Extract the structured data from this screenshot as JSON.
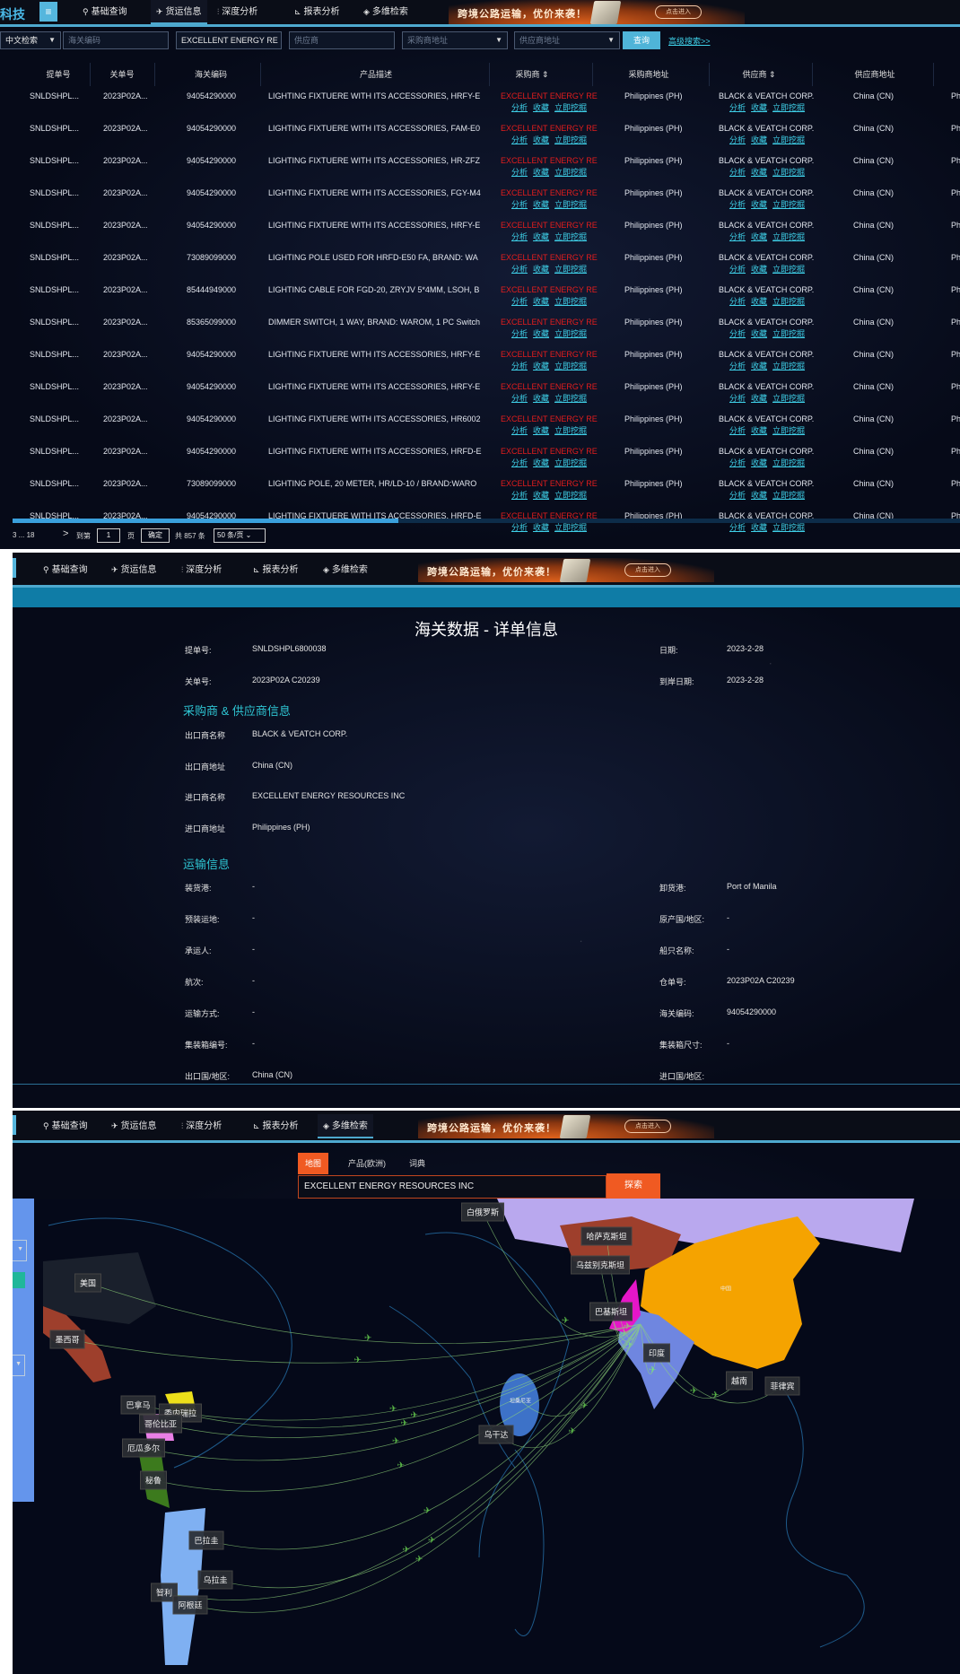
{
  "nav": {
    "logo": "科技",
    "menu_icon": "≡",
    "items": [
      "基础查询",
      "货运信息",
      "深度分析",
      "报表分析",
      "多维检索"
    ],
    "banner_text": "跨境公路运输，优价来袭！",
    "banner_button": "点击进入"
  },
  "filters": {
    "lang_select": "中文检索",
    "hs_placeholder": "海关编码",
    "buyer_value": "EXCELLENT ENERGY RE",
    "supplier_placeholder": "供应商",
    "buyer_addr_placeholder": "采购商地址",
    "supplier_addr_placeholder": "供应商地址",
    "query_button": "查询",
    "advanced_link": "高级搜索>>"
  },
  "table": {
    "headers": [
      "提单号",
      "关单号",
      "海关编码",
      "产品描述",
      "采购商 ⇕",
      "采购商地址",
      "供应商 ⇕",
      "供应商地址"
    ],
    "link_labels": [
      "分析",
      "收藏",
      "立即挖掘"
    ],
    "rows": [
      {
        "bill": "SNLDSHPL...",
        "customs": "2023P02A...",
        "hs": "94054290000",
        "desc": "LIGHTING FIXTUERE WITH ITS ACCESSORIES, HRFY-E",
        "buyer": "EXCELLENT ENERGY RE",
        "buyer_addr": "Philippines (PH)",
        "supplier": "BLACK & VEATCH CORP.",
        "supplier_addr": "China (CN)",
        "extra": "Ph"
      },
      {
        "bill": "SNLDSHPL...",
        "customs": "2023P02A...",
        "hs": "94054290000",
        "desc": "LIGHTING FIXTUERE WITH ITS ACCESSORIES, FAM-E0",
        "buyer": "EXCELLENT ENERGY RE",
        "buyer_addr": "Philippines (PH)",
        "supplier": "BLACK & VEATCH CORP.",
        "supplier_addr": "China (CN)",
        "extra": "Ph"
      },
      {
        "bill": "SNLDSHPL...",
        "customs": "2023P02A...",
        "hs": "94054290000",
        "desc": "LIGHTING FIXTUERE WITH ITS ACCESSORIES, HR-ZFZ",
        "buyer": "EXCELLENT ENERGY RE",
        "buyer_addr": "Philippines (PH)",
        "supplier": "BLACK & VEATCH CORP.",
        "supplier_addr": "China (CN)",
        "extra": "Ph"
      },
      {
        "bill": "SNLDSHPL...",
        "customs": "2023P02A...",
        "hs": "94054290000",
        "desc": "LIGHTING FIXTUERE WITH ITS ACCESSORIES, FGY-M4",
        "buyer": "EXCELLENT ENERGY RE",
        "buyer_addr": "Philippines (PH)",
        "supplier": "BLACK & VEATCH CORP.",
        "supplier_addr": "China (CN)",
        "extra": "Ph"
      },
      {
        "bill": "SNLDSHPL...",
        "customs": "2023P02A...",
        "hs": "94054290000",
        "desc": "LIGHTING FIXTUERE WITH ITS ACCESSORIES, HRFY-E",
        "buyer": "EXCELLENT ENERGY RE",
        "buyer_addr": "Philippines (PH)",
        "supplier": "BLACK & VEATCH CORP.",
        "supplier_addr": "China (CN)",
        "extra": "Ph"
      },
      {
        "bill": "SNLDSHPL...",
        "customs": "2023P02A...",
        "hs": "73089099000",
        "desc": "LIGHTING POLE USED FOR HRFD-E50 FA, BRAND: WA",
        "buyer": "EXCELLENT ENERGY RE",
        "buyer_addr": "Philippines (PH)",
        "supplier": "BLACK & VEATCH CORP.",
        "supplier_addr": "China (CN)",
        "extra": "Ph"
      },
      {
        "bill": "SNLDSHPL...",
        "customs": "2023P02A...",
        "hs": "85444949000",
        "desc": "LIGHTING CABLE FOR FGD-20, ZRYJV 5*4MM, LSOH, B",
        "buyer": "EXCELLENT ENERGY RE",
        "buyer_addr": "Philippines (PH)",
        "supplier": "BLACK & VEATCH CORP.",
        "supplier_addr": "China (CN)",
        "extra": "Ph"
      },
      {
        "bill": "SNLDSHPL...",
        "customs": "2023P02A...",
        "hs": "85365099000",
        "desc": "DIMMER SWITCH, 1 WAY, BRAND: WAROM, 1 PC Switch",
        "buyer": "EXCELLENT ENERGY RE",
        "buyer_addr": "Philippines (PH)",
        "supplier": "BLACK & VEATCH CORP.",
        "supplier_addr": "China (CN)",
        "extra": "Ph"
      },
      {
        "bill": "SNLDSHPL...",
        "customs": "2023P02A...",
        "hs": "94054290000",
        "desc": "LIGHTING FIXTUERE WITH ITS ACCESSORIES, HRFY-E",
        "buyer": "EXCELLENT ENERGY RE",
        "buyer_addr": "Philippines (PH)",
        "supplier": "BLACK & VEATCH CORP.",
        "supplier_addr": "China (CN)",
        "extra": "Ph"
      },
      {
        "bill": "SNLDSHPL...",
        "customs": "2023P02A...",
        "hs": "94054290000",
        "desc": "LIGHTING FIXTUERE WITH ITS ACCESSORIES, HRFY-E",
        "buyer": "EXCELLENT ENERGY RE",
        "buyer_addr": "Philippines (PH)",
        "supplier": "BLACK & VEATCH CORP.",
        "supplier_addr": "China (CN)",
        "extra": "Ph"
      },
      {
        "bill": "SNLDSHPL...",
        "customs": "2023P02A...",
        "hs": "94054290000",
        "desc": "LIGHTING FIXTUERE WITH ITS ACCESSORIES, HR6002",
        "buyer": "EXCELLENT ENERGY RE",
        "buyer_addr": "Philippines (PH)",
        "supplier": "BLACK & VEATCH CORP.",
        "supplier_addr": "China (CN)",
        "extra": "Ph"
      },
      {
        "bill": "SNLDSHPL...",
        "customs": "2023P02A...",
        "hs": "94054290000",
        "desc": "LIGHTING FIXTUERE WITH ITS ACCESSORIES, HRFD-E",
        "buyer": "EXCELLENT ENERGY RE",
        "buyer_addr": "Philippines (PH)",
        "supplier": "BLACK & VEATCH CORP.",
        "supplier_addr": "China (CN)",
        "extra": "Ph"
      },
      {
        "bill": "SNLDSHPL...",
        "customs": "2023P02A...",
        "hs": "73089099000",
        "desc": "LIGHTING POLE, 20 METER, HR/LD-10 / BRAND:WARO",
        "buyer": "EXCELLENT ENERGY RE",
        "buyer_addr": "Philippines (PH)",
        "supplier": "BLACK & VEATCH CORP.",
        "supplier_addr": "China (CN)",
        "extra": "Ph"
      },
      {
        "bill": "SNLDSHPL...",
        "customs": "2023P02A...",
        "hs": "94054290000",
        "desc": "LIGHTING FIXTUERE WITH ITS ACCESSORIES, HRFD-E",
        "buyer": "EXCELLENT ENERGY RE",
        "buyer_addr": "Philippines (PH)",
        "supplier": "BLACK & VEATCH CORP.",
        "supplier_addr": "China (CN)",
        "extra": "Ph"
      }
    ]
  },
  "pagination": {
    "pages_text": "3 ... 18",
    "next": ">",
    "goto_label": "到第",
    "page_value": "1",
    "page_unit": "页",
    "confirm": "确定",
    "total": "共 857 条",
    "page_size": "50 条/页"
  },
  "detail": {
    "title": "海关数据 - 详单信息",
    "top": [
      {
        "label": "提单号:",
        "value": "SNLDSHPL6800038",
        "label2": "日期:",
        "value2": "2023-2-28"
      },
      {
        "label": "关单号:",
        "value": "2023P02A C20239",
        "label2": "到岸日期:",
        "value2": "2023-2-28"
      }
    ],
    "party_section": "采购商 & 供应商信息",
    "party": [
      {
        "label": "出口商名称",
        "value": "BLACK & VEATCH CORP."
      },
      {
        "label": "出口商地址",
        "value": "China (CN)"
      },
      {
        "label": "进口商名称",
        "value": "EXCELLENT ENERGY RESOURCES INC"
      },
      {
        "label": "进口商地址",
        "value": "Philippines (PH)"
      }
    ],
    "shipping_section": "运输信息",
    "shipping": [
      {
        "label": "装货港:",
        "value": "-",
        "label2": "卸货港:",
        "value2": "Port of Manila"
      },
      {
        "label": "预装运地:",
        "value": "-",
        "label2": "原产国/地区:",
        "value2": "-"
      },
      {
        "label": "承运人:",
        "value": "-",
        "label2": "船只名称:",
        "value2": "-"
      },
      {
        "label": "航次:",
        "value": "-",
        "label2": "仓单号:",
        "value2": "2023P02A C20239"
      },
      {
        "label": "运输方式:",
        "value": "-",
        "label2": "海关编码:",
        "value2": "94054290000"
      },
      {
        "label": "集装箱编号:",
        "value": "-",
        "label2": "集装箱尺寸:",
        "value2": "-"
      },
      {
        "label": "出口国/地区:",
        "value": "China (CN)",
        "label2": "进口国/地区:",
        "value2": ""
      }
    ]
  },
  "map": {
    "tabs": [
      "地图",
      "产品(欧洲)",
      "词典"
    ],
    "search_value": "EXCELLENT ENERGY RESOURCES INC",
    "search_button": "探索",
    "labels": [
      "白俄罗斯",
      "哈萨克斯坦",
      "乌兹别克斯坦",
      "美国",
      "巴基斯坦",
      "墨西哥",
      "印度",
      "越南",
      "菲律宾",
      "坦桑尼亚",
      "巴拿马",
      "委内瑞拉",
      "哥伦比亚",
      "乌干达",
      "厄瓜多尔",
      "秘鲁",
      "巴拉圭",
      "乌拉圭",
      "智利",
      "阿根廷",
      "中国"
    ],
    "colors": {
      "china": "#f5a300",
      "russia": "#b9a8ee",
      "brown": "#9e3f2c",
      "india": "#6f86e0",
      "magenta": "#e516c8",
      "route": "#7cff5a"
    }
  }
}
